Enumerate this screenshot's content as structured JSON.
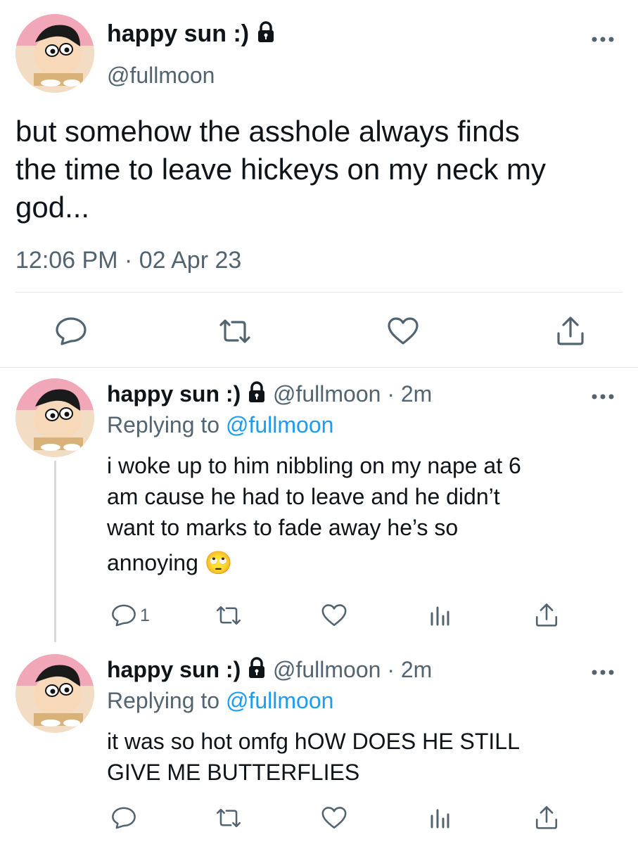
{
  "main_tweet": {
    "display_name": "happy sun :)",
    "handle": "@fullmoon",
    "text": "but somehow the asshole always finds the time to leave hickeys on my neck my god...",
    "line1": "but somehow the asshole always finds",
    "line2": "the time to leave hickeys on my neck my",
    "line3": "god...",
    "timestamp": "12:06 PM · 02 Apr 23",
    "icons": [
      "reply-icon",
      "retweet-icon",
      "like-icon",
      "share-icon"
    ]
  },
  "replies": [
    {
      "display_name": "happy sun :)",
      "handle": "@fullmoon",
      "time": "2m",
      "replying_to_label": "Replying to",
      "replying_to_handle": "@fullmoon",
      "line1": "i woke up to him nibbling on my nape at 6",
      "line2": "am cause he had to leave and he didn’t",
      "line3": "want to marks to fade away he’s so",
      "line4": "annoying",
      "emoji": "🙄",
      "reply_count": "1",
      "icons": [
        "reply-icon",
        "retweet-icon",
        "like-icon",
        "analytics-icon",
        "share-icon"
      ]
    },
    {
      "display_name": "happy sun :)",
      "handle": "@fullmoon",
      "time": "2m",
      "replying_to_label": "Replying to",
      "replying_to_handle": "@fullmoon",
      "line1": "it was so hot omfg hOW DOES HE STILL",
      "line2": "GIVE ME BUTTERFLIES",
      "icons": [
        "reply-icon",
        "retweet-icon",
        "like-icon",
        "analytics-icon",
        "share-icon"
      ]
    }
  ],
  "colors": {
    "text": "#0f1419",
    "muted": "#536471",
    "link": "#1d9bf0",
    "divider": "#e6e6e6"
  }
}
